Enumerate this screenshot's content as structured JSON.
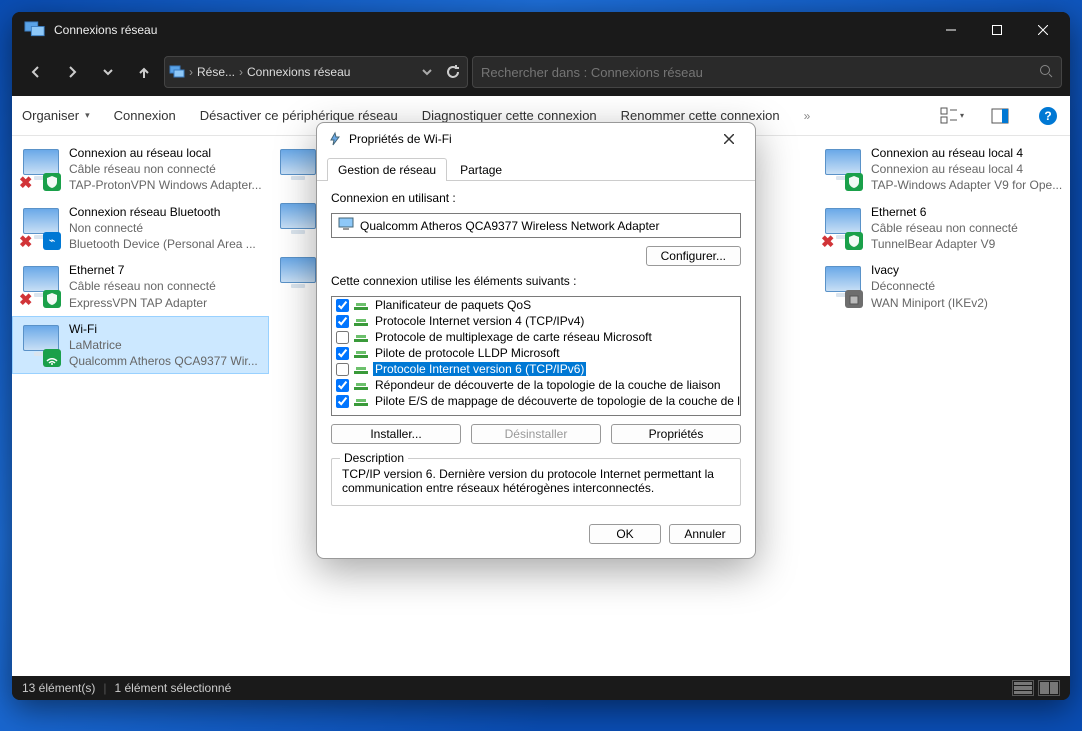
{
  "window": {
    "title": "Connexions réseau"
  },
  "address": {
    "seg1": "Rése...",
    "seg2": "Connexions réseau"
  },
  "search": {
    "placeholder": "Rechercher dans : Connexions réseau"
  },
  "toolbar": {
    "organize": "Organiser",
    "connection": "Connexion",
    "disable": "Désactiver ce périphérique réseau",
    "diagnose": "Diagnostiquer cette connexion",
    "rename": "Renommer cette connexion",
    "overflow": "»"
  },
  "connections": [
    {
      "name": "Connexion au réseau local",
      "sub1": "Câble réseau non connecté",
      "sub2": "TAP-ProtonVPN Windows Adapter...",
      "disconnected": true,
      "overlay": "shield",
      "overlay_bg": "#1aa04a"
    },
    {
      "name": "Connexion réseau Bluetooth",
      "sub1": "Non connecté",
      "sub2": "Bluetooth Device (Personal Area ...",
      "disconnected": true,
      "overlay": "bt",
      "overlay_bg": "#0078d4"
    },
    {
      "name": "Ethernet 7",
      "sub1": "Câble réseau non connecté",
      "sub2": "ExpressVPN TAP Adapter",
      "disconnected": true,
      "overlay": "shield",
      "overlay_bg": "#1aa04a"
    },
    {
      "name": "Wi-Fi",
      "sub1": "LaMatrice",
      "sub2": "Qualcomm Atheros QCA9377 Wir...",
      "disconnected": false,
      "overlay": "wifi",
      "overlay_bg": "#1aa04a",
      "selected": true
    }
  ],
  "connections_col2": [
    {
      "name": "",
      "sub1": "",
      "sub2": ""
    },
    {
      "name": "",
      "sub1": "",
      "sub2": ""
    },
    {
      "name": "",
      "sub1": "",
      "sub2": ""
    }
  ],
  "connections_col3": [
    {
      "name": "Connexion au réseau local 4",
      "sub1": "Connexion au réseau local 4",
      "sub2": "TAP-Windows Adapter V9 for Ope...",
      "disconnected": false,
      "overlay": "shield",
      "overlay_bg": "#1aa04a"
    },
    {
      "name": "Ethernet 6",
      "sub1": "Câble réseau non connecté",
      "sub2": "TunnelBear Adapter V9",
      "disconnected": true,
      "overlay": "shield",
      "overlay_bg": "#1aa04a"
    },
    {
      "name": "Ivacy",
      "sub1": "Déconnecté",
      "sub2": "WAN Miniport (IKEv2)",
      "disconnected": false,
      "overlay": "wan",
      "overlay_bg": "#6e6e6e"
    }
  ],
  "statusbar": {
    "count": "13 élément(s)",
    "selected": "1 élément sélectionné"
  },
  "dialog": {
    "title": "Propriétés de Wi-Fi",
    "tabs": {
      "network": "Gestion de réseau",
      "sharing": "Partage"
    },
    "connect_using_label": "Connexion en utilisant :",
    "adapter": "Qualcomm Atheros QCA9377 Wireless Network Adapter",
    "configure": "Configurer...",
    "elements_label": "Cette connexion utilise les éléments suivants :",
    "elements": [
      {
        "checked": true,
        "label": "Planificateur de paquets QoS",
        "selected": false
      },
      {
        "checked": true,
        "label": "Protocole Internet version 4 (TCP/IPv4)",
        "selected": false
      },
      {
        "checked": false,
        "label": "Protocole de multiplexage de carte réseau Microsoft",
        "selected": false
      },
      {
        "checked": true,
        "label": "Pilote de protocole LLDP Microsoft",
        "selected": false
      },
      {
        "checked": false,
        "label": "Protocole Internet version 6 (TCP/IPv6)",
        "selected": true
      },
      {
        "checked": true,
        "label": "Répondeur de découverte de la topologie de la couche de liaison",
        "selected": false
      },
      {
        "checked": true,
        "label": "Pilote E/S de mappage de découverte de topologie de la couche de li",
        "selected": false
      }
    ],
    "install": "Installer...",
    "uninstall": "Désinstaller",
    "properties": "Propriétés",
    "description_legend": "Description",
    "description": "TCP/IP version 6. Dernière version du protocole Internet permettant la communication entre réseaux hétérogènes interconnectés.",
    "ok": "OK",
    "cancel": "Annuler"
  }
}
